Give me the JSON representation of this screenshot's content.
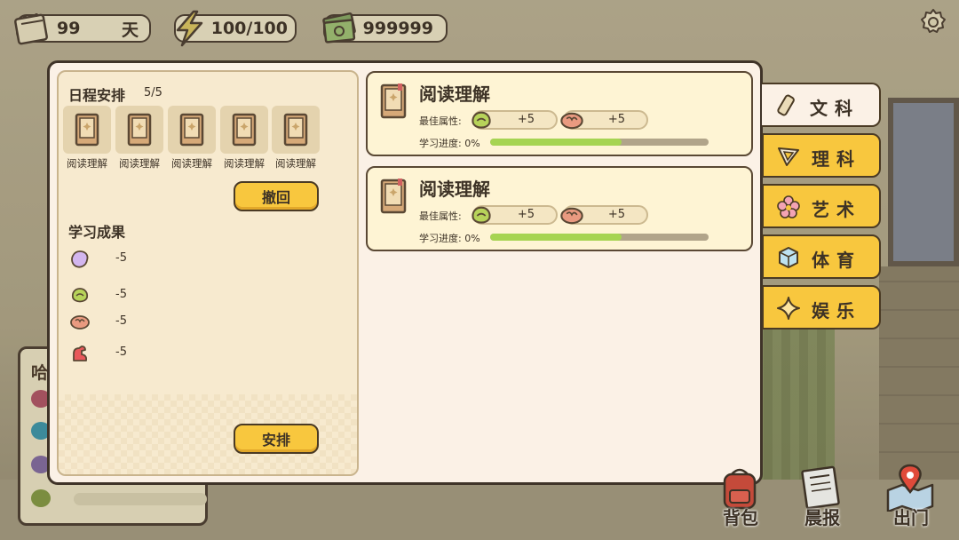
{
  "hud": {
    "day_value": "99",
    "day_unit": "天",
    "energy": "100/100",
    "money": "999999"
  },
  "side_panel": {
    "title": "哈"
  },
  "schedule": {
    "title": "日程安排",
    "count": "5/5",
    "slots": [
      {
        "label": "阅读理解"
      },
      {
        "label": "阅读理解"
      },
      {
        "label": "阅读理解"
      },
      {
        "label": "阅读理解"
      },
      {
        "label": "阅读理解"
      }
    ],
    "undo_label": "撤回",
    "results_title": "学习成果",
    "results": [
      {
        "icon": "purple-blob-icon",
        "value": "-5"
      },
      {
        "icon": "green-cabbage-icon",
        "value": "-5"
      },
      {
        "icon": "brain-icon",
        "value": "-5"
      },
      {
        "icon": "muscle-arm-icon",
        "value": "-5"
      }
    ],
    "arrange_label": "安排"
  },
  "courses": [
    {
      "title": "阅读理解",
      "best_attr_label": "最佳属性:",
      "attr1_value": "+5",
      "attr2_value": "+5",
      "progress_label": "学习进度:",
      "progress_text": "0%",
      "progress_fill": 0.6
    },
    {
      "title": "阅读理解",
      "best_attr_label": "最佳属性:",
      "attr1_value": "+5",
      "attr2_value": "+5",
      "progress_label": "学习进度:",
      "progress_text": "0%",
      "progress_fill": 0.6
    }
  ],
  "tabs": [
    {
      "label": "文科",
      "icon": "scroll-icon",
      "active": true
    },
    {
      "label": "理科",
      "icon": "triangle-ruler-icon",
      "active": false
    },
    {
      "label": "艺术",
      "icon": "flower-icon",
      "active": false
    },
    {
      "label": "体育",
      "icon": "cube-icon",
      "active": false
    },
    {
      "label": "娱乐",
      "icon": "star-icon",
      "active": false
    }
  ],
  "bottom_buttons": [
    {
      "label": "背包",
      "icon": "backpack-icon"
    },
    {
      "label": "晨报",
      "icon": "newspaper-icon"
    },
    {
      "label": "出门",
      "icon": "map-pin-icon"
    }
  ],
  "colors": {
    "accent_yellow": "#f8c73e",
    "progress_green": "#a6d452",
    "panel_cream": "#fbf1e6",
    "border_brown": "#3f3328"
  }
}
